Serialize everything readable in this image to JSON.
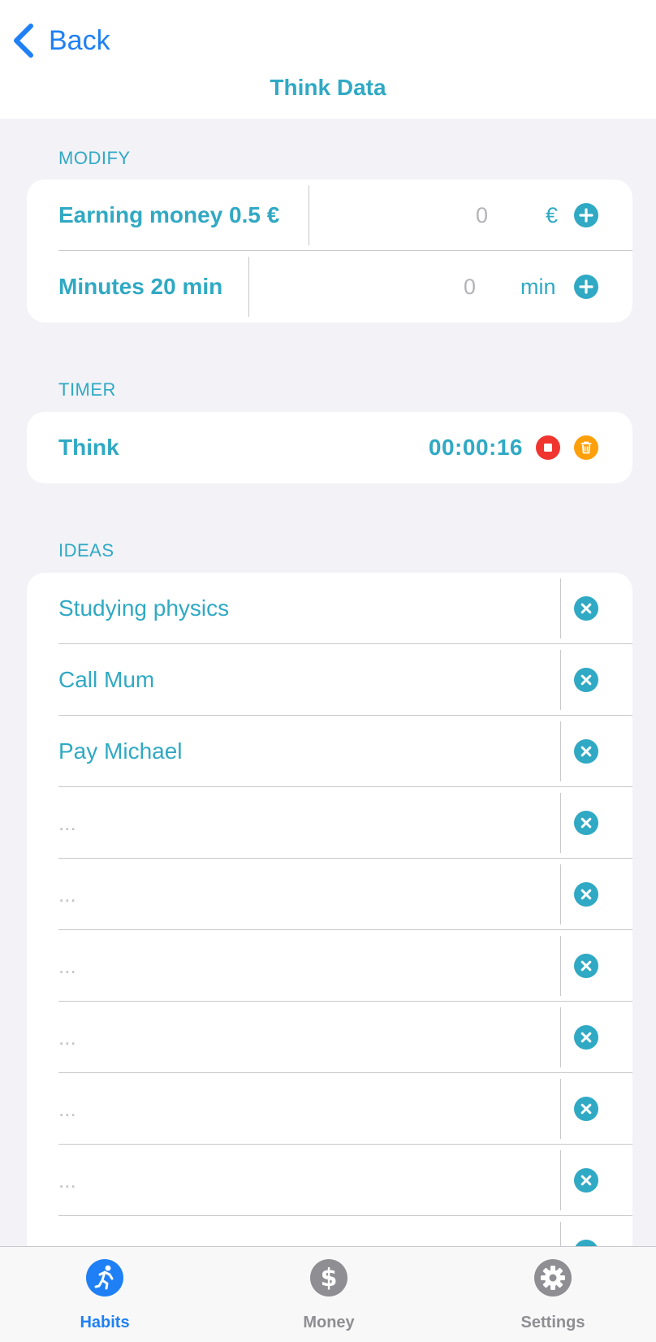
{
  "nav": {
    "back_label": "Back",
    "title": "Think Data"
  },
  "modify": {
    "header": "MODIFY",
    "rows": [
      {
        "label": "Earning money 0.5 €",
        "value": "0",
        "unit": "€",
        "icon": "plus-circle-icon"
      },
      {
        "label": "Minutes 20 min",
        "value": "0",
        "unit": "min",
        "icon": "plus-circle-icon"
      }
    ]
  },
  "timer": {
    "header": "TIMER",
    "name": "Think",
    "elapsed": "00:00:16",
    "stop_icon": "stop-circle-icon",
    "delete_icon": "trash-circle-icon"
  },
  "ideas": {
    "header": "IDEAS",
    "items": [
      {
        "text": "Studying physics"
      },
      {
        "text": "Call Mum"
      },
      {
        "text": "Pay Michael"
      },
      {
        "text": "..."
      },
      {
        "text": "..."
      },
      {
        "text": "..."
      },
      {
        "text": "..."
      },
      {
        "text": "..."
      },
      {
        "text": "..."
      }
    ]
  },
  "tabs": [
    {
      "label": "Habits",
      "icon": "running-figure-icon",
      "active": true
    },
    {
      "label": "Money",
      "icon": "dollar-circle-icon",
      "active": false
    },
    {
      "label": "Settings",
      "icon": "gear-icon",
      "active": false
    }
  ],
  "colors": {
    "accent": "#30a9c4",
    "link_blue": "#1f80f5",
    "stop_red": "#f0352e",
    "delete_orange": "#ff9f0a",
    "tab_inactive": "#8e8e93",
    "background": "#f2f2f7"
  }
}
